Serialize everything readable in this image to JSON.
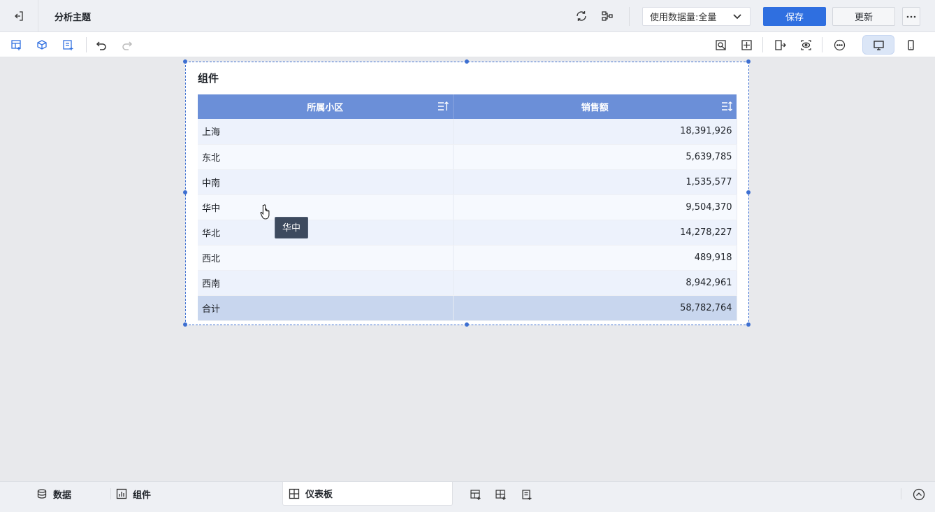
{
  "header": {
    "title": "分析主题",
    "data_volume_label": "使用数据量:",
    "data_volume_value": "全量",
    "save_label": "保存",
    "update_label": "更新"
  },
  "widget": {
    "title": "组件",
    "columns": [
      "所属小区",
      "销售额"
    ],
    "rows": [
      {
        "region": "上海",
        "sales": "18,391,926"
      },
      {
        "region": "东北",
        "sales": "5,639,785"
      },
      {
        "region": "中南",
        "sales": "1,535,577"
      },
      {
        "region": "华中",
        "sales": "9,504,370"
      },
      {
        "region": "华北",
        "sales": "14,278,227"
      },
      {
        "region": "西北",
        "sales": "489,918"
      },
      {
        "region": "西南",
        "sales": "8,942,961"
      }
    ],
    "total": {
      "label": "合计",
      "value": "58,782,764"
    },
    "tooltip": "华中"
  },
  "bottom": {
    "tabs": [
      "数据",
      "组件",
      "仪表板"
    ],
    "active_tab": "仪表板"
  },
  "colors": {
    "primary": "#2f6fe0",
    "header_bg": "#6b8fd8",
    "selection": "#3d6fd1"
  }
}
